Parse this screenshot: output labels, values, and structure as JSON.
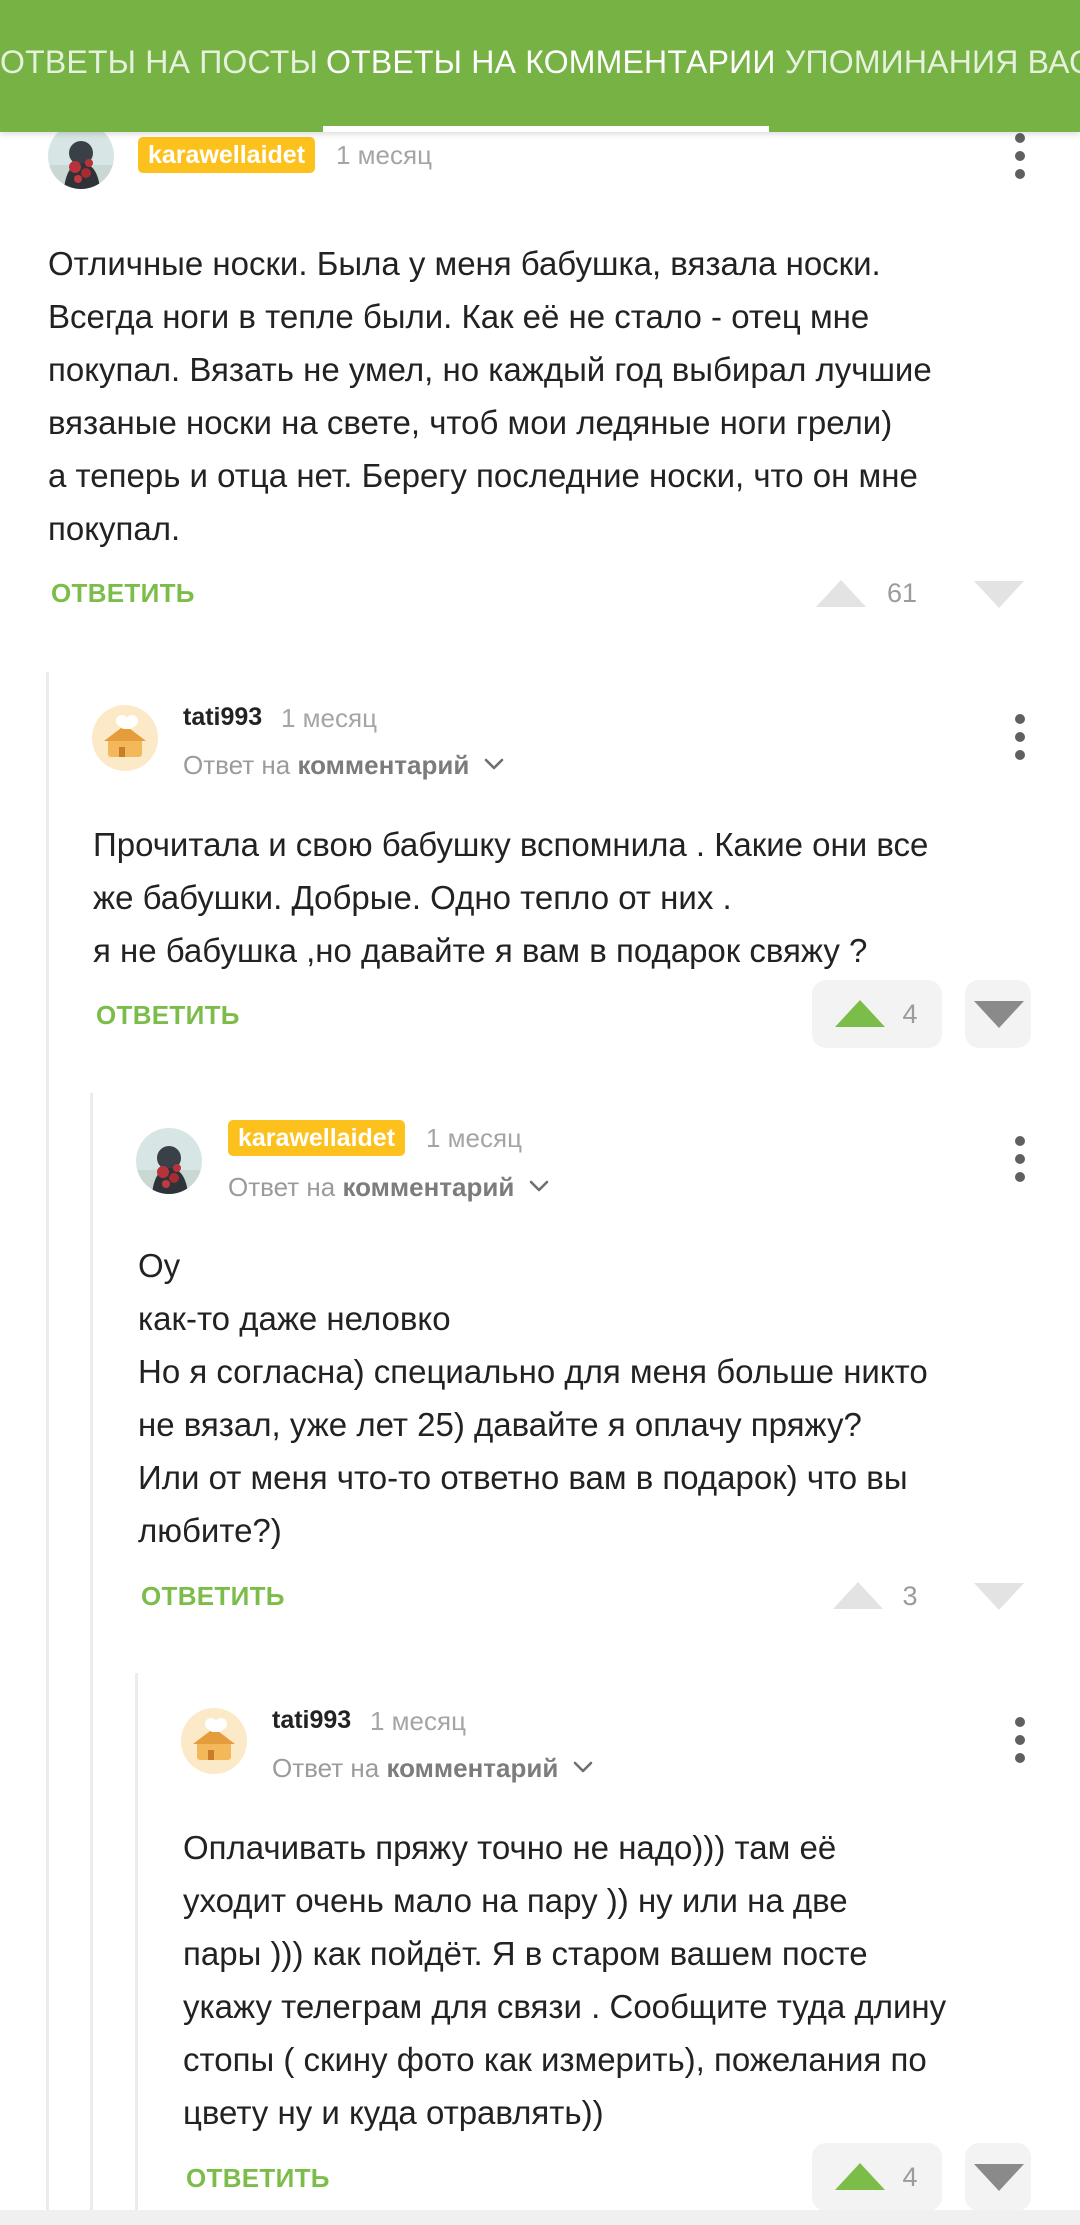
{
  "tabs": [
    {
      "label": "ОТВЕТЫ НА ПОСТЫ"
    },
    {
      "label": "ОТВЕТЫ НА КОММЕНТАРИИ"
    },
    {
      "label": "УПОМИНАНИЯ ВАС"
    }
  ],
  "colors": {
    "brand_green": "#76b244",
    "reply_green": "#7cbd4a",
    "badge_yellow": "#fdc11e"
  },
  "comments": [
    {
      "username": "karawellaidet",
      "time": "1 месяц",
      "text": "Отличные носки. Была у меня бабушка, вязала носки.\nВсегда ноги в тепле были. Как её не стало - отец мне\nпокупал. Вязать не умел, но каждый год выбирал лучшие\nвязаные носки на свете, чтоб мои ледяные ноги грели)\nа теперь и отца нет. Берегу последние носки, что он мне\nпокупал.",
      "reply_label": "ОТВЕТИТЬ",
      "votes": "61",
      "upvoted": false
    },
    {
      "username": "tati993",
      "time": "1 месяц",
      "reply_prefix": "Ответ на",
      "reply_target": "комментарий",
      "text": "Прочитала и свою бабушку вспомнила . Какие они все\nже бабушки. Добрые. Одно тепло от них .\nя не бабушка ,но давайте я вам в подарок свяжу ?",
      "reply_label": "ОТВЕТИТЬ",
      "votes": "4",
      "upvoted": true
    },
    {
      "username": "karawellaidet",
      "time": "1 месяц",
      "reply_prefix": "Ответ на",
      "reply_target": "комментарий",
      "text": "Оу\nкак-то даже неловко\nНо я согласна) специально для меня больше никто\nне вязал, уже лет 25) давайте я оплачу пряжу?\nИли от меня что-то ответно вам в подарок) что вы\nлюбите?)",
      "reply_label": "ОТВЕТИТЬ",
      "votes": "3",
      "upvoted": false
    },
    {
      "username": "tati993",
      "time": "1 месяц",
      "reply_prefix": "Ответ на",
      "reply_target": "комментарий",
      "text": "Оплачивать пряжу точно не надо))) там её\nуходит очень мало на пару )) ну или на две\nпары ))) как пойдёт. Я в старом вашем посте\nукажу телеграм для связи . Сообщите туда длину\nстопы ( скину фото как измерить), пожелания по\nцвету ну и куда отравлять))",
      "reply_label": "ОТВЕТИТЬ",
      "votes": "4",
      "upvoted": true
    }
  ]
}
